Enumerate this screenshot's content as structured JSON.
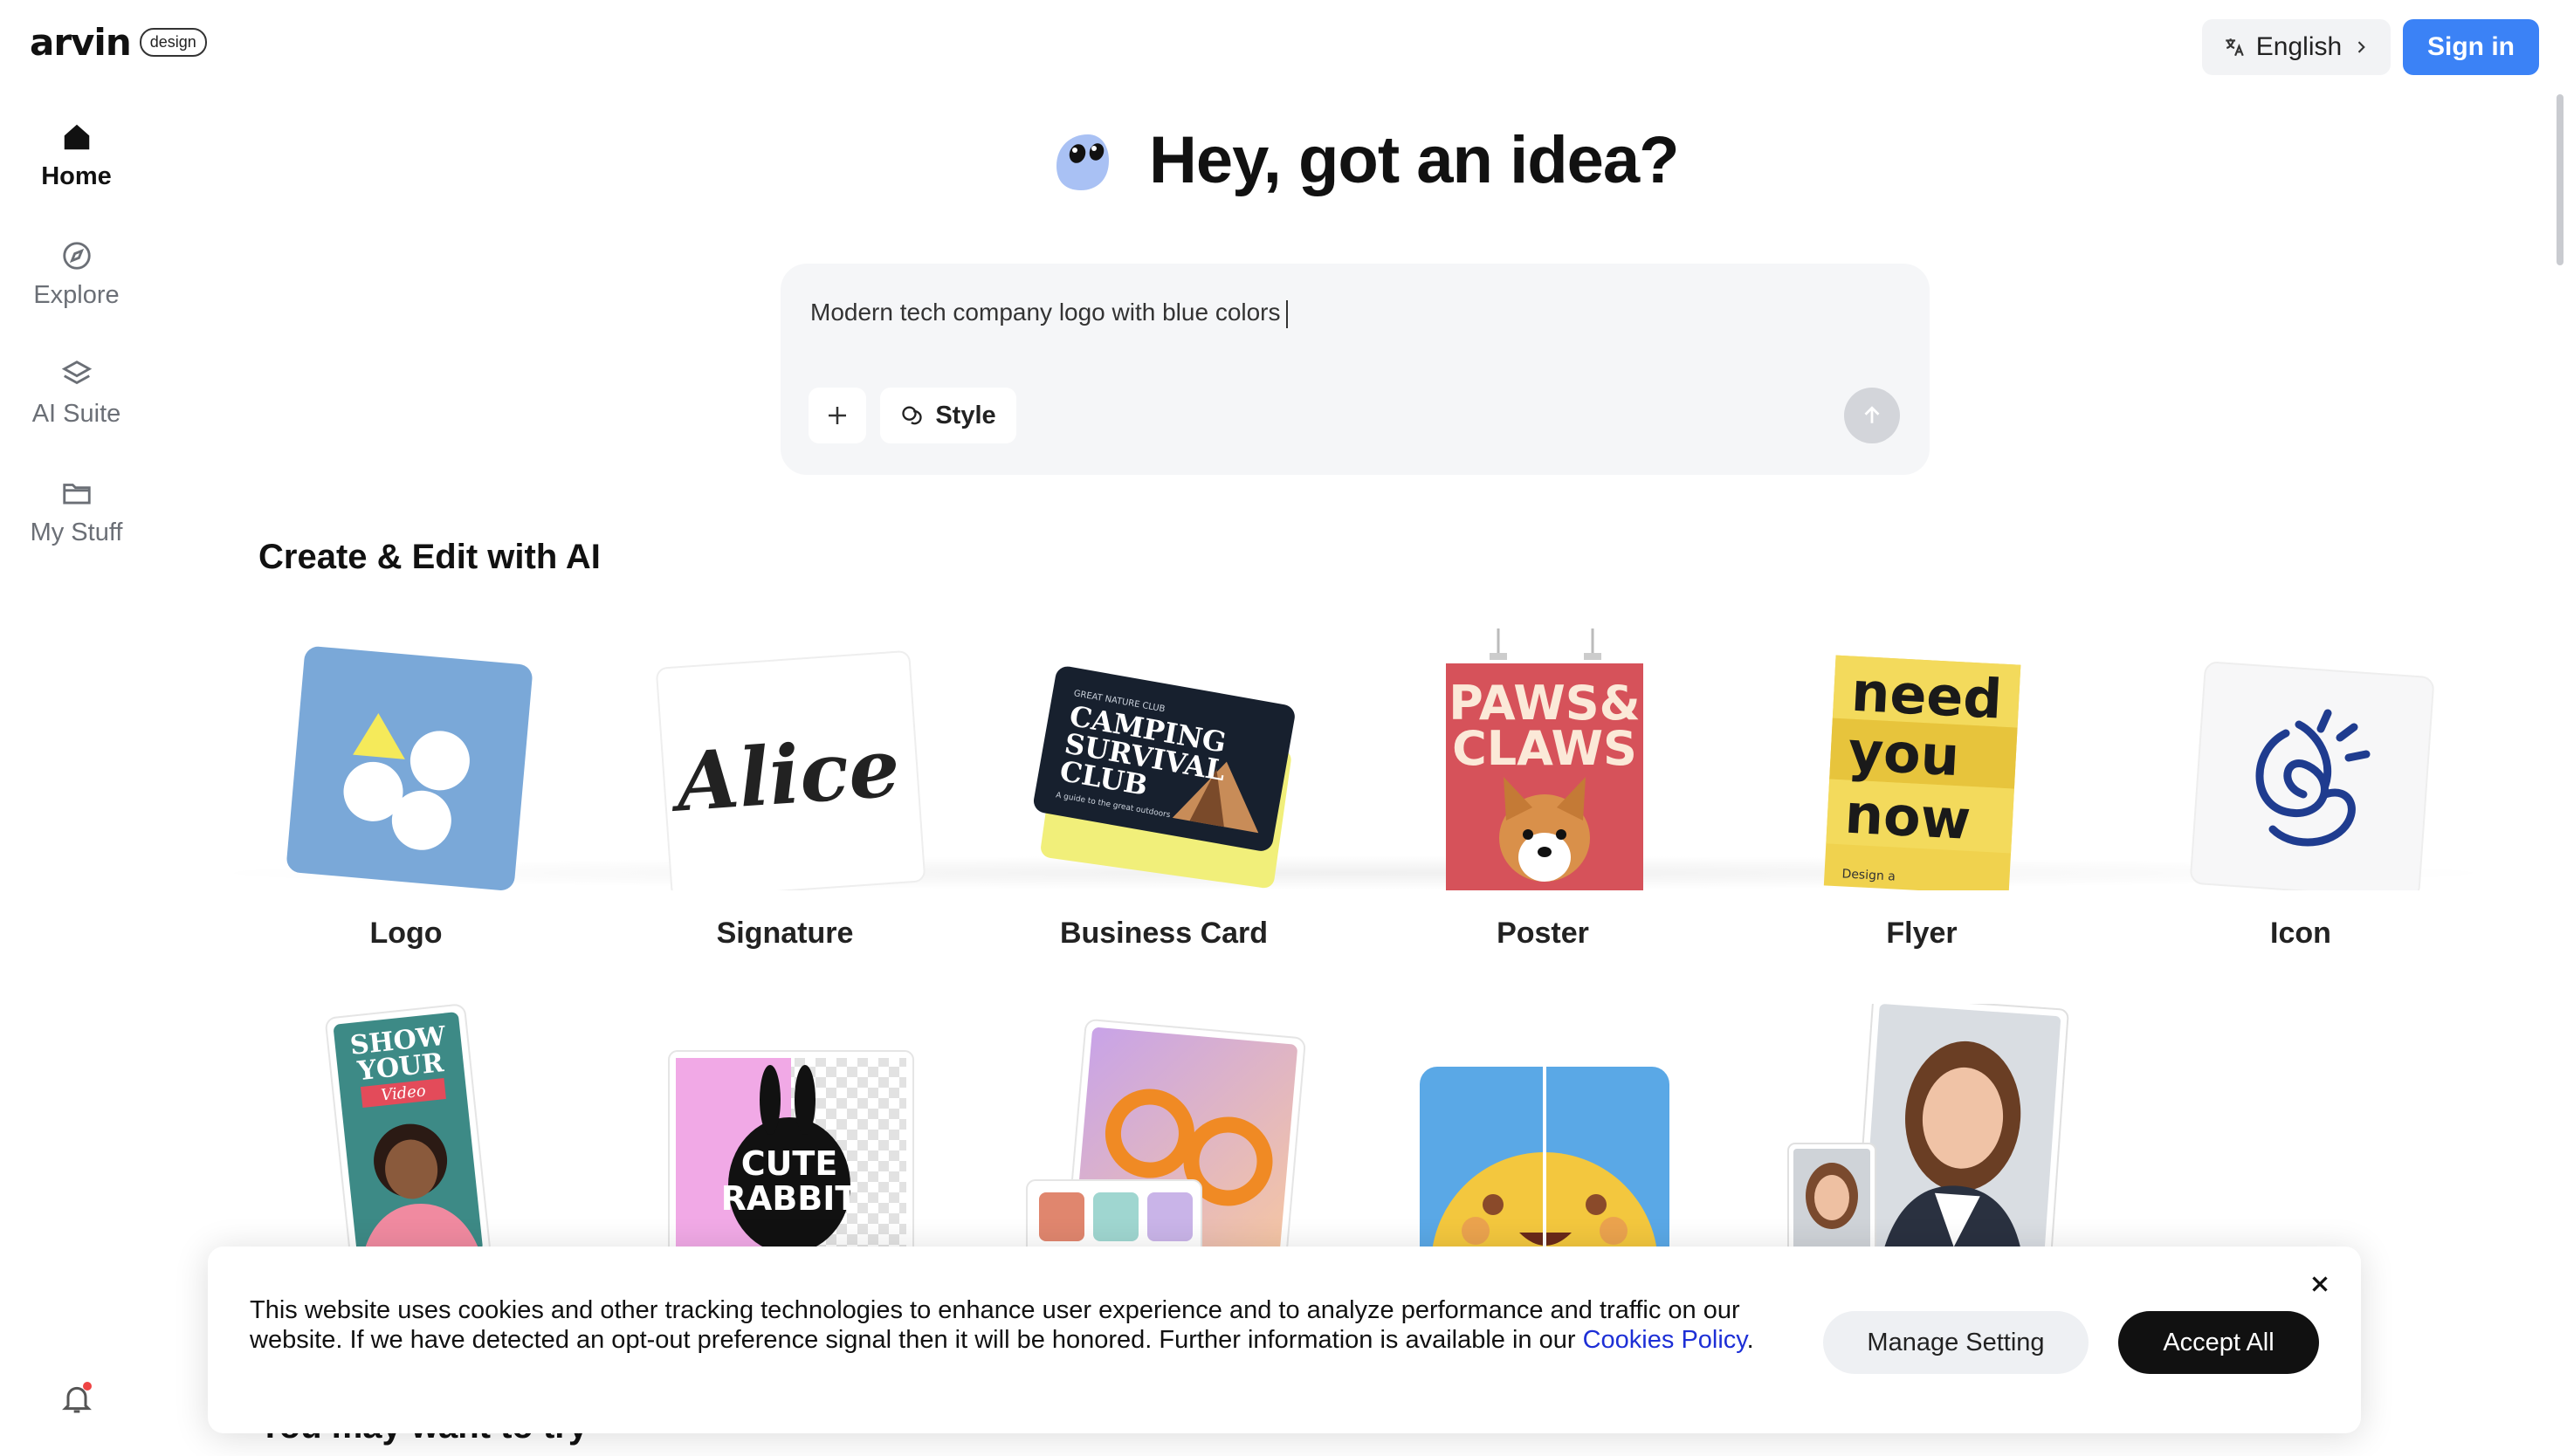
{
  "brand": {
    "name": "arvin",
    "tag": "design"
  },
  "header": {
    "language": "English",
    "signin": "Sign in"
  },
  "sidebar": {
    "items": [
      {
        "label": "Home",
        "icon": "home-icon",
        "active": true
      },
      {
        "label": "Explore",
        "icon": "compass-icon",
        "active": false
      },
      {
        "label": "AI Suite",
        "icon": "layers-icon",
        "active": false
      },
      {
        "label": "My Stuff",
        "icon": "folder-icon",
        "active": false
      }
    ]
  },
  "hero": {
    "title": "Hey, got an idea?"
  },
  "prompt": {
    "value": "Modern tech company logo with blue colors",
    "style_label": "Style"
  },
  "section": {
    "title": "Create & Edit with AI"
  },
  "cards": {
    "row1": [
      {
        "label": "Logo"
      },
      {
        "label": "Signature"
      },
      {
        "label": "Business Card"
      },
      {
        "label": "Poster"
      },
      {
        "label": "Flyer"
      },
      {
        "label": "Icon"
      }
    ]
  },
  "thumbs": {
    "signature_text": "Alice",
    "bizcard": {
      "club": "GREAT NATURE CLUB",
      "line1": "CAMPING",
      "line2": "SURVIVAL",
      "line3": "CLUB",
      "tagline": "A guide to the great outdoors"
    },
    "poster": {
      "line1": "PAWS&",
      "line2": "CLAWS"
    },
    "flyer": {
      "line1": "need",
      "line2": "you",
      "line3": "now",
      "footer": "Design a"
    },
    "video": {
      "line1": "SHOW",
      "line2": "YOUR",
      "line3": "Video"
    },
    "rabbit": {
      "line1": "CUTE",
      "line2": "RABBIT"
    }
  },
  "cookie": {
    "text": "This website uses cookies and other tracking technologies to enhance user experience and to analyze performance and traffic on our website. If we have detected an opt-out preference signal then it will be honored. Further information is available in our",
    "link": "Cookies Policy",
    "manage": "Manage Setting",
    "accept": "Accept All"
  },
  "next_section": {
    "title": "You may want to try"
  },
  "colors": {
    "accent": "#3b82f6",
    "dark": "#111111",
    "panel": "#f5f6f8"
  }
}
